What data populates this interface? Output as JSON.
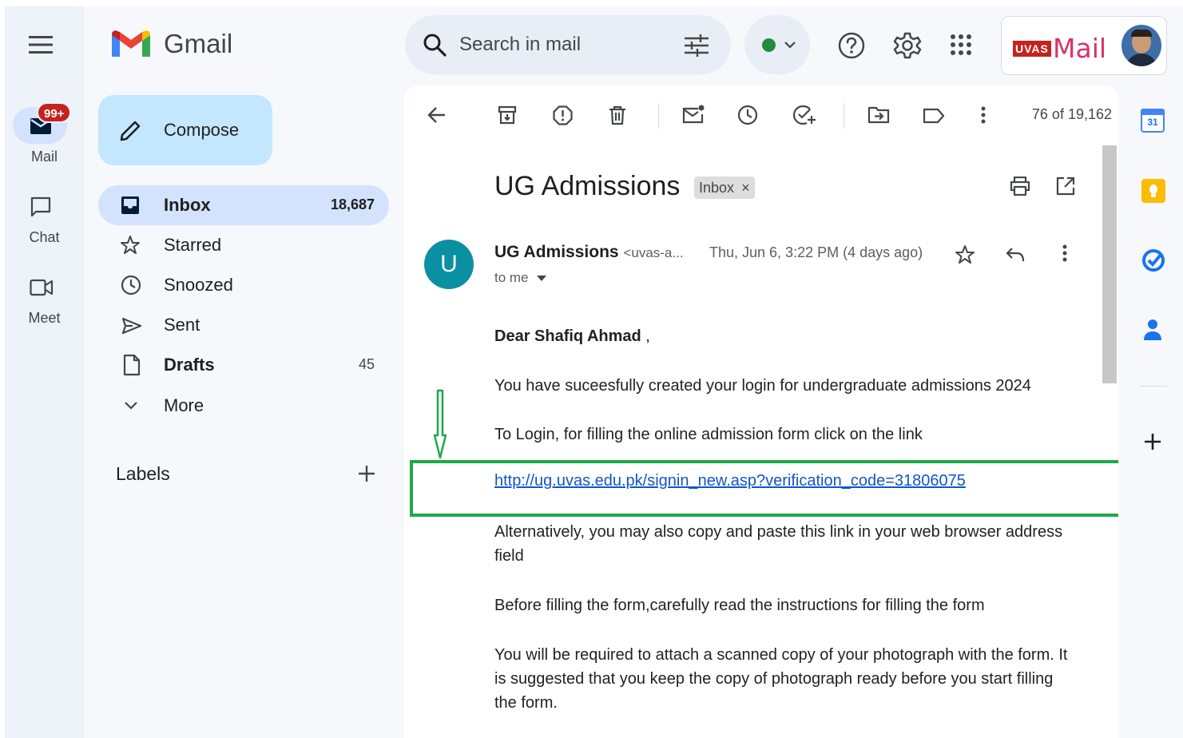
{
  "header": {
    "app_name": "Gmail",
    "search_placeholder": "Search in mail",
    "status_color": "#1e8e3e",
    "brand_logo_text": "UVAS",
    "brand_mail_text": "Mail"
  },
  "rail": {
    "mail_label": "Mail",
    "mail_badge": "99+",
    "chat_label": "Chat",
    "meet_label": "Meet"
  },
  "sidebar": {
    "compose_label": "Compose",
    "items": [
      {
        "label": "Inbox",
        "count": "18,687"
      },
      {
        "label": "Starred",
        "count": ""
      },
      {
        "label": "Snoozed",
        "count": ""
      },
      {
        "label": "Sent",
        "count": ""
      },
      {
        "label": "Drafts",
        "count": "45"
      },
      {
        "label": "More",
        "count": ""
      }
    ],
    "labels_title": "Labels"
  },
  "toolbar": {
    "counter": "76 of 19,162"
  },
  "email": {
    "subject": "UG Admissions",
    "label_chip": "Inbox",
    "chip_close": "×",
    "avatar_letter": "U",
    "sender_name": "UG Admissions",
    "sender_email": "<uvas-a...",
    "date": "Thu, Jun 6, 3:22 PM (4 days ago)",
    "to": "to me",
    "greeting_name": "Dear Shafiq Ahmad",
    "greeting_suffix": " ,",
    "p1": "You have suceesfully created your login for undergraduate admissions 2024",
    "p2": "To Login, for filling the online admission form click on the link",
    "link": "http://ug.uvas.edu.pk/signin_new.asp?verification_code=31806075",
    "p3": "Alternatively, you may also copy and paste this link in your web browser address field",
    "p4": "Before filling the form,carefully read the instructions for filling the form",
    "p5": "You will be required to attach a scanned copy of your photograph with the form. It is suggested that you keep the copy of photograph ready before you start filling the form."
  },
  "right_panel": {
    "calendar_day": "31"
  },
  "colors": {
    "annotation": "#1fa84a",
    "accent": "#0b57d0"
  }
}
